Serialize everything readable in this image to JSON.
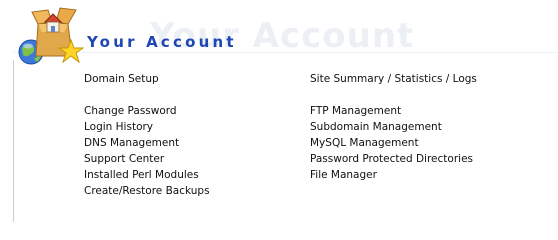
{
  "page": {
    "heading": "Your Account",
    "heading_shadow": "Your Account",
    "logo_icon": "account-box-globe-star-icon",
    "colors": {
      "heading": "#1e46b4",
      "heading_shadow": "#eceff3",
      "link_text": "#111111",
      "rule": "#c4cfde"
    }
  },
  "left_links": [
    "Domain Setup",
    "Change Password",
    "Login History",
    "DNS Management",
    "Support Center",
    "Installed Perl Modules",
    "Create/Restore Backups"
  ],
  "right_links": [
    "Site Summary / Statistics / Logs",
    "FTP Management",
    "Subdomain Management",
    "MySQL Management",
    "Password Protected Directories",
    "File Manager"
  ]
}
